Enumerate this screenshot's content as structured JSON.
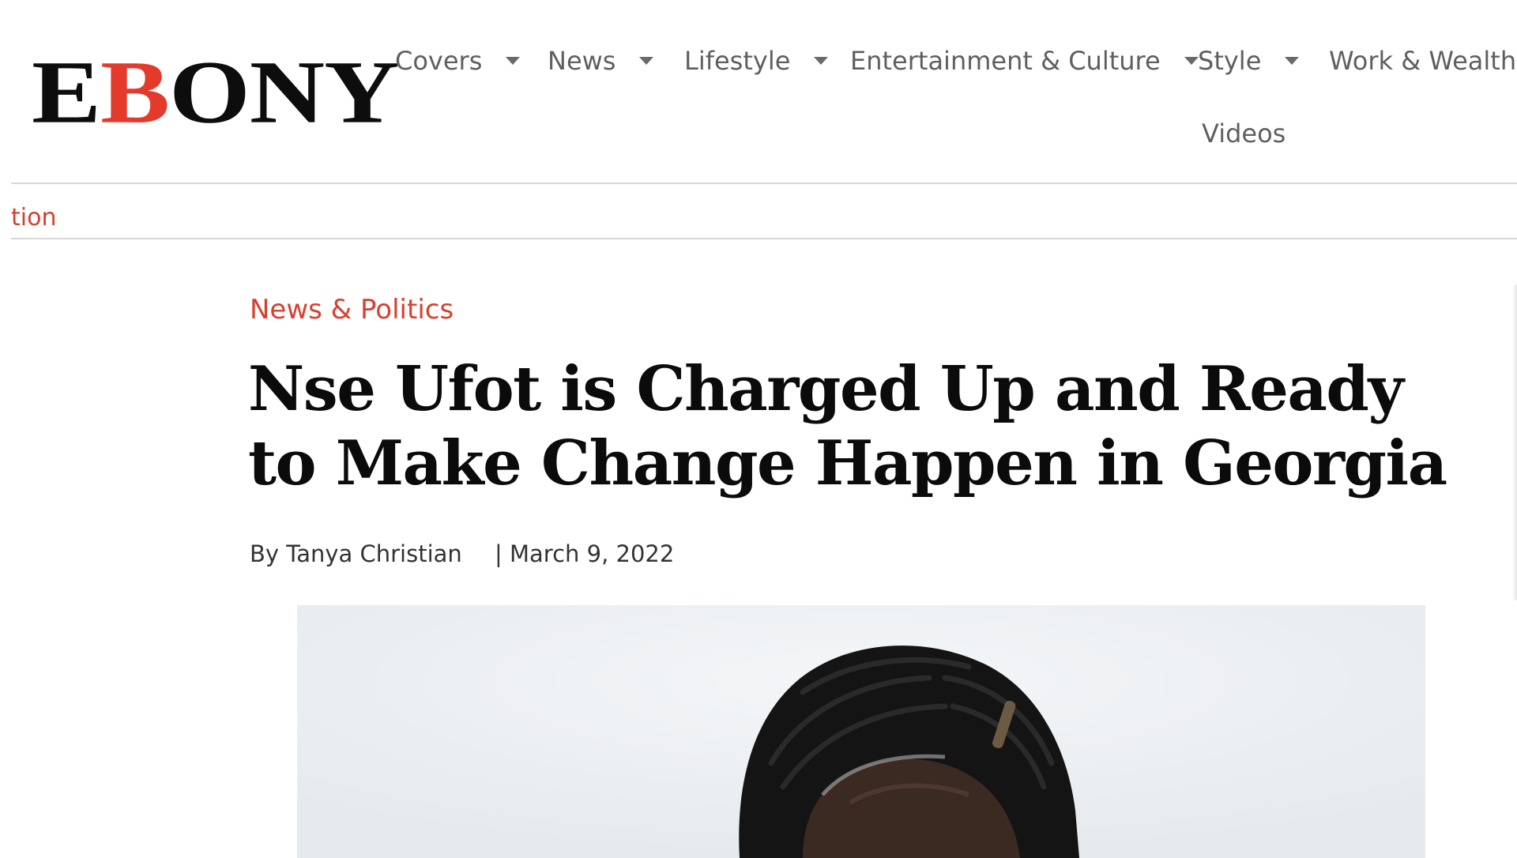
{
  "logo": {
    "prefix": "E",
    "accent": "B",
    "suffix": "ONY"
  },
  "nav": {
    "items": [
      {
        "label": "Covers"
      },
      {
        "label": "News"
      },
      {
        "label": "Lifestyle"
      },
      {
        "label": "Entertainment & Culture"
      },
      {
        "label": "Style"
      },
      {
        "label": "Work & Wealth"
      },
      {
        "label": "Videos"
      }
    ]
  },
  "ticker": {
    "text": "tion"
  },
  "article": {
    "category": "News & Politics",
    "title": "Nse Ufot is Charged Up and Ready to Make Change Happen in Georgia",
    "byline": "By Tanya Christian",
    "date_sep": "|",
    "date": "March 9, 2022"
  },
  "colors": {
    "brand_red": "#e43a2c",
    "link_red": "#d6402f",
    "nav_text": "#5f5f5f"
  },
  "icons": {
    "dropdown": "chevron-down-icon"
  }
}
